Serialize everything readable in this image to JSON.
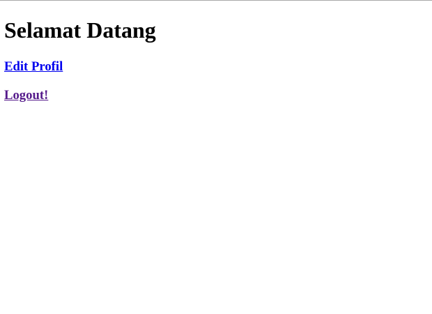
{
  "header": {
    "title": "Selamat Datang"
  },
  "links": {
    "edit_profile": "Edit Profil",
    "logout": "Logout!"
  },
  "colors": {
    "link_unvisited": "#0000ee",
    "link_visited": "#551a8b",
    "text": "#000000",
    "background": "#ffffff"
  }
}
